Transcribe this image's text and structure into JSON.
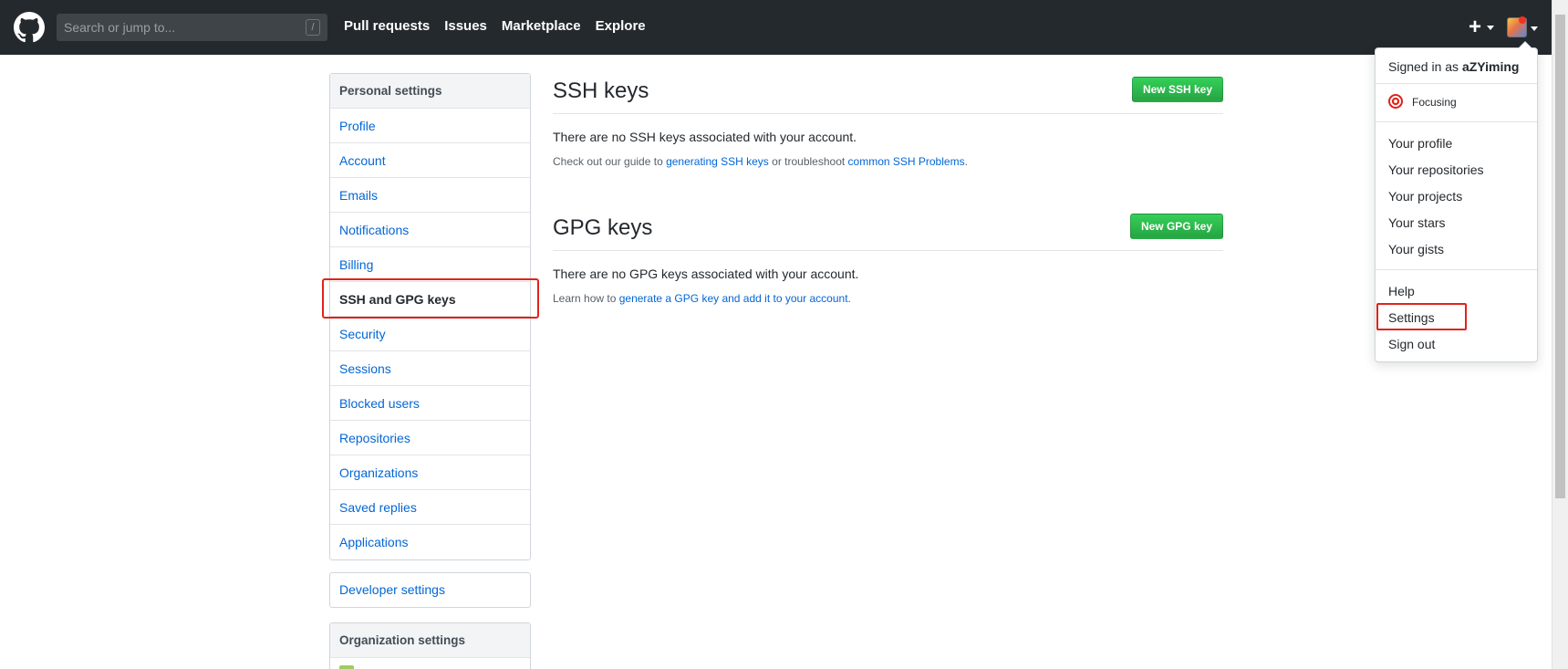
{
  "header": {
    "search_placeholder": "Search or jump to...",
    "search_shortcut": "/",
    "nav": [
      "Pull requests",
      "Issues",
      "Marketplace",
      "Explore"
    ],
    "plus_label": "+"
  },
  "sidebar": {
    "heading": "Personal settings",
    "items": [
      {
        "label": "Profile"
      },
      {
        "label": "Account"
      },
      {
        "label": "Emails"
      },
      {
        "label": "Notifications"
      },
      {
        "label": "Billing"
      },
      {
        "label": "SSH and GPG keys",
        "selected": true
      },
      {
        "label": "Security"
      },
      {
        "label": "Sessions"
      },
      {
        "label": "Blocked users"
      },
      {
        "label": "Repositories"
      },
      {
        "label": "Organizations"
      },
      {
        "label": "Saved replies"
      },
      {
        "label": "Applications"
      }
    ],
    "developer_settings": "Developer settings",
    "org_heading": "Organization settings"
  },
  "ssh": {
    "title": "SSH keys",
    "button": "New SSH key",
    "empty": "There are no SSH keys associated with your account.",
    "help_prefix": "Check out our guide to ",
    "help_link1": "generating SSH keys",
    "help_middle": " or troubleshoot ",
    "help_link2": "common SSH Problems",
    "help_suffix": "."
  },
  "gpg": {
    "title": "GPG keys",
    "button": "New GPG key",
    "empty": "There are no GPG keys associated with your account.",
    "help_prefix": "Learn how to ",
    "help_link": "generate a GPG key and add it to your account",
    "help_suffix": "."
  },
  "dropdown": {
    "signed_in_prefix": "Signed in as ",
    "username": "aZYiming",
    "status": "Focusing",
    "items_group1": [
      "Your profile",
      "Your repositories",
      "Your projects",
      "Your stars",
      "Your gists"
    ],
    "items_group2": [
      "Help",
      "Settings",
      "Sign out"
    ]
  },
  "colors": {
    "header_bg": "#24292e",
    "link": "#0366d6",
    "button_green": "#28a745",
    "highlight": "#e0231a"
  }
}
